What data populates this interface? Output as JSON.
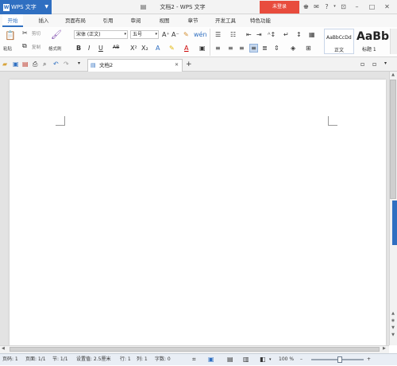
{
  "titlebar": {
    "app_name": "WPS 文字",
    "logo_letter": "W",
    "doc_title": "文档2 - WPS 文字",
    "login_button": "未登录"
  },
  "tabs": [
    "开始",
    "插入",
    "页面布局",
    "引用",
    "审阅",
    "视图",
    "章节",
    "开发工具",
    "特色功能"
  ],
  "ribbon": {
    "paste": "粘贴",
    "cut": "剪切",
    "copy": "复制",
    "format_painter": "格式刷",
    "font_family": "宋体 (正文)",
    "font_size": "五号",
    "style_normal_preview": "AaBbCcDd",
    "style_normal": "正文",
    "style_heading_preview": "AaBb",
    "style_heading": "标题 1"
  },
  "document_tab": {
    "title": "文档2"
  },
  "status": {
    "page": "页码: 1",
    "pages": "页面: 1/1",
    "section": "节: 1/1",
    "setting": "设置值: 2.5厘米",
    "row": "行: 1",
    "col": "列: 1",
    "words": "字数: 0",
    "zoom": "100 %",
    "zoom_fraction": 0.55
  },
  "colors": {
    "accent": "#2f6fc1",
    "login": "#e84c3d"
  }
}
